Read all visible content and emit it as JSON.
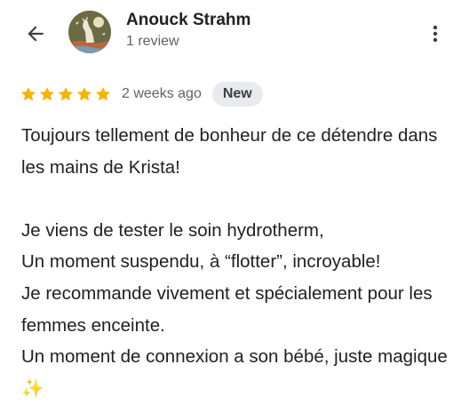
{
  "reviewer": {
    "name": "Anouck Strahm",
    "reviews_count": "1 review",
    "avatar_icon": "howling-wolf-avatar"
  },
  "header": {
    "back_icon": "arrow-left-icon",
    "menu_icon": "more-vert-icon"
  },
  "review": {
    "rating": 5,
    "rating_max": 5,
    "time": "2 weeks ago",
    "badge": "New",
    "text": "Toujours tellement de bonheur de ce détendre dans les mains de Krista!\n\nJe viens de tester le soin hydrotherm,\nUn moment suspendu, à “flotter”, incroyable!\nJe recommande vivement et spécialement pour les femmes enceinte.\nUn moment de connexion a son bébé, juste magique ✨"
  },
  "colors": {
    "star": "#f4b400",
    "text": "#202124",
    "secondary_text": "#5f6368",
    "badge_bg": "#e8eaed"
  }
}
